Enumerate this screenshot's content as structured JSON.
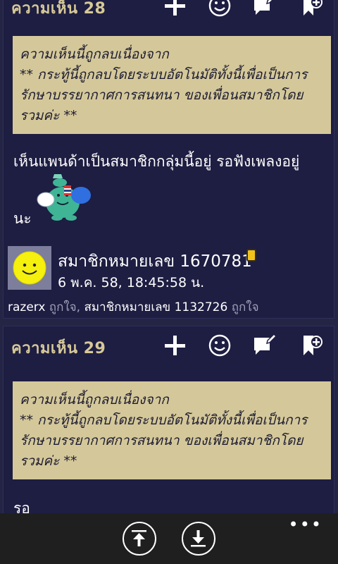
{
  "posts": [
    {
      "title": "ความเห็น 28",
      "deleted_line1": "ความเห็นนี้ถูกลบเนื่องจาก",
      "deleted_line2": "** กระทู้นี้ถูกลบโดยระบบอัตโนมัติทั้งนี้เพื่อเป็นการ",
      "deleted_line3": "รักษาบรรยากาศการสนทนา ของเพื่อนสมาชิกโดย",
      "deleted_line4": "รวมค่ะ **",
      "body_line1": "เห็นแพนด้าเป็นสมาชิกกลุ่มนี้อยู่  รอฟังเพลงอยู่",
      "body_line2": "นะ",
      "username": "สมาชิกหมายเลข 1670781",
      "timestamp": "6 พ.ค. 58, 18:45:58 น.",
      "like_name1": "razerx",
      "like_word1": " ถูกใจ, ",
      "like_name2": "สมาชิกหมายเลข 1132726",
      "like_word2": " ถูกใจ"
    },
    {
      "title": "ความเห็น 29",
      "deleted_line1": "ความเห็นนี้ถูกลบเนื่องจาก",
      "deleted_line2": "** กระทู้นี้ถูกลบโดยระบบอัตโนมัติทั้งนี้เพื่อเป็นการ",
      "deleted_line3": "รักษาบรรยากาศการสนทนา ของเพื่อนสมาชิกโดย",
      "deleted_line4": "รวมค่ะ **",
      "body_line1": "รอ"
    }
  ],
  "icons": {
    "add": "plus-icon",
    "emoticon": "smiley-icon",
    "reply": "comment-edit-icon",
    "bookmark": "bookmark-add-icon"
  },
  "bottom_bar": {
    "more": "•••"
  },
  "colors": {
    "background": "#242444",
    "card": "#1e1d42",
    "title": "#d6c998",
    "deleted_box": "#d4c89a",
    "app_bar": "#1f1f1f"
  }
}
